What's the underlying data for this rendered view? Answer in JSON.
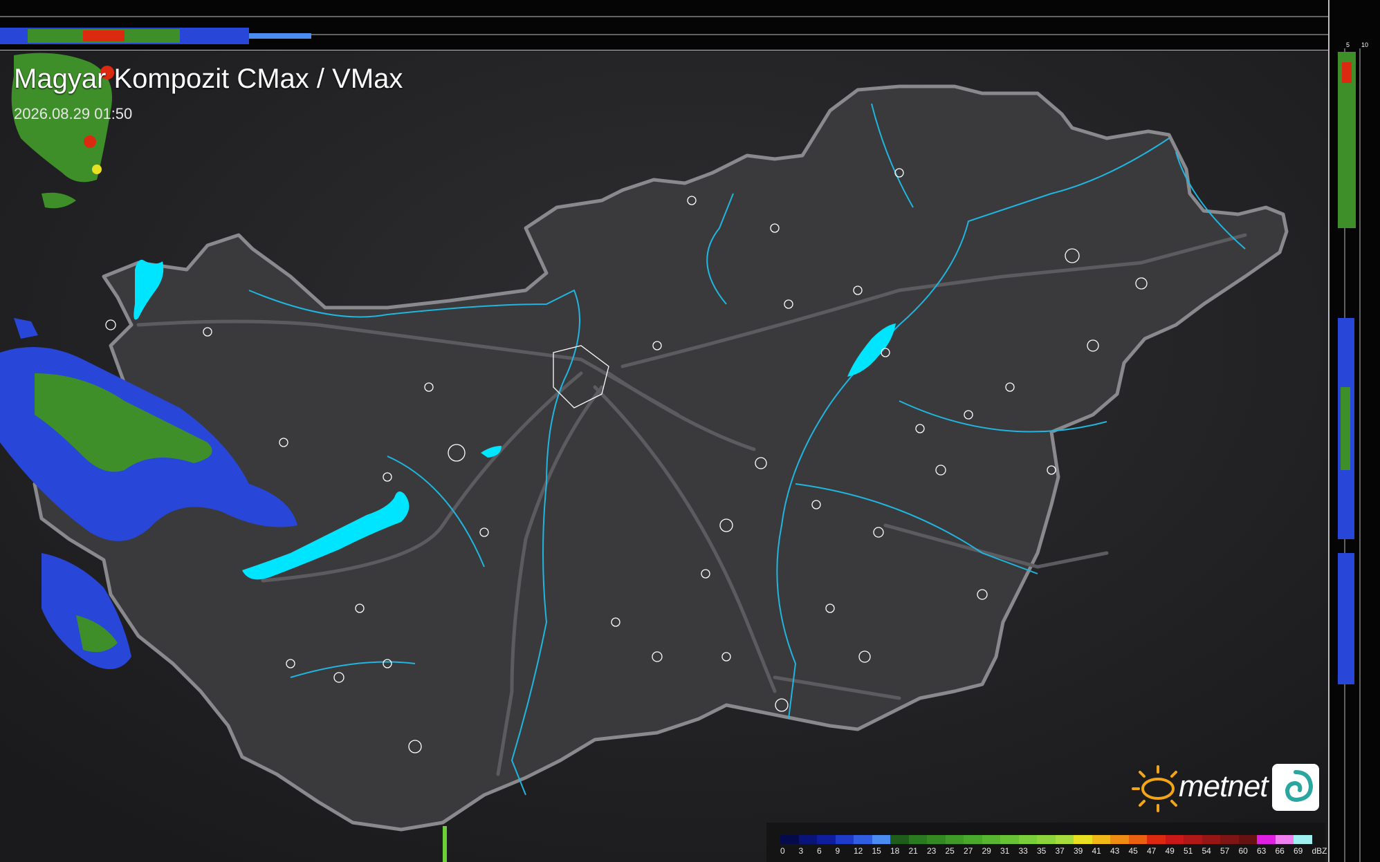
{
  "map": {
    "title": "Magyar Kompozit CMax / VMax",
    "timestamp": "2026.08.29 01:50",
    "profile_axis_labels": {
      "top_10": "10",
      "top_5": "5",
      "side_5": "5",
      "side_10": "10"
    }
  },
  "legend": {
    "unit": "dBZ",
    "values": [
      "0",
      "3",
      "6",
      "9",
      "12",
      "15",
      "18",
      "21",
      "23",
      "25",
      "27",
      "29",
      "31",
      "33",
      "35",
      "37",
      "39",
      "41",
      "43",
      "45",
      "47",
      "49",
      "51",
      "54",
      "57",
      "60",
      "63",
      "66",
      "69"
    ],
    "colors": [
      "#050a4a",
      "#0a1478",
      "#0f1e9c",
      "#1f3cc8",
      "#2f5fe0",
      "#4a8cf0",
      "#1f5e1a",
      "#2a7a1f",
      "#348a22",
      "#3f9a27",
      "#4aa82c",
      "#57b530",
      "#68c235",
      "#7ace3a",
      "#8dd43c",
      "#a6dc3c",
      "#e8e020",
      "#f0b818",
      "#ee8c14",
      "#e86010",
      "#dc2a10",
      "#c81818",
      "#b01818",
      "#961616",
      "#7e1414",
      "#661212",
      "#e020e0",
      "#f080f0",
      "#a0f0f0"
    ]
  },
  "brand": {
    "name": "metnet",
    "sun_icon": "sun-icon",
    "swirl_icon": "swirl-icon",
    "accent_color": "#f2a516"
  },
  "colors": {
    "background": "#1b1b1d",
    "country_fill": "#3a3a3d",
    "border": "#8a8a8e",
    "rivers": "#1fb6e0",
    "lakes": "#00e5ff",
    "towns": "#ffffff"
  }
}
